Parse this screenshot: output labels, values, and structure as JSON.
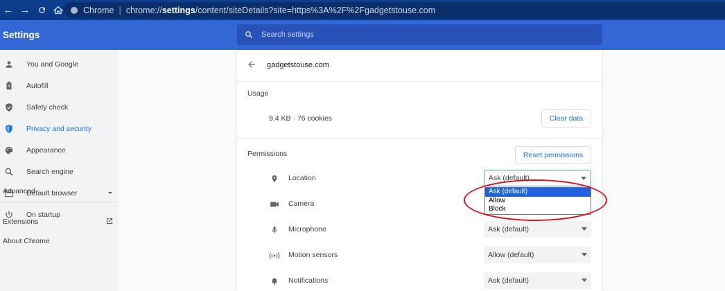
{
  "browser": {
    "omnibox_label": "Chrome",
    "url_prefix": "chrome://",
    "url_bold": "settings",
    "url_rest": "/content/siteDetails?site=https%3A%2F%2Fgadgetstouse.com"
  },
  "header": {
    "title": "Settings",
    "search_placeholder": "Search settings"
  },
  "sidebar": {
    "items": [
      {
        "label": "You and Google",
        "icon": "person-icon"
      },
      {
        "label": "Autofill",
        "icon": "clipboard-icon"
      },
      {
        "label": "Safety check",
        "icon": "shield-check-icon"
      },
      {
        "label": "Privacy and security",
        "icon": "shield-icon",
        "active": true
      },
      {
        "label": "Appearance",
        "icon": "palette-icon"
      },
      {
        "label": "Search engine",
        "icon": "search-icon"
      },
      {
        "label": "Default browser",
        "icon": "browser-icon"
      },
      {
        "label": "On startup",
        "icon": "power-icon"
      }
    ],
    "advanced_label": "Advanced",
    "extensions_label": "Extensions",
    "about_label": "About Chrome"
  },
  "site": {
    "title": "gadgetstouse.com",
    "usage_heading": "Usage",
    "usage_value": "9.4 KB · 76 cookies",
    "clear_label": "Clear data",
    "permissions_heading": "Permissions",
    "reset_label": "Reset permissions"
  },
  "permissions": [
    {
      "label": "Location",
      "value": "Ask (default)",
      "icon": "location-pin-icon",
      "open": true
    },
    {
      "label": "Camera",
      "value": "Ask (default)",
      "icon": "camera-icon"
    },
    {
      "label": "Microphone",
      "value": "Ask (default)",
      "icon": "microphone-icon"
    },
    {
      "label": "Motion sensors",
      "value": "Allow (default)",
      "icon": "sensors-icon"
    },
    {
      "label": "Notifications",
      "value": "Ask (default)",
      "icon": "bell-icon"
    }
  ],
  "dropdown_options": [
    "Ask (default)",
    "Allow",
    "Block"
  ],
  "colors": {
    "accent": "#1a73e8",
    "header": "#3367d6",
    "highlight": "#e0131b"
  }
}
